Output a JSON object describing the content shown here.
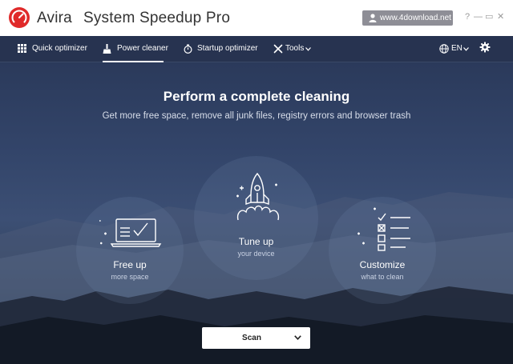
{
  "titlebar": {
    "brand": "Avira",
    "product": "System Speedup Pro",
    "account_label": "www.4download.net",
    "help": "?",
    "minimize": "—",
    "restore": "▭",
    "close": "✕"
  },
  "nav": {
    "items": [
      {
        "label": "Quick optimizer",
        "icon": "grid-icon"
      },
      {
        "label": "Power cleaner",
        "icon": "broom-icon"
      },
      {
        "label": "Startup optimizer",
        "icon": "stopwatch-icon"
      },
      {
        "label": "Tools",
        "icon": "tools-icon"
      }
    ],
    "active": "Power cleaner",
    "language": "EN"
  },
  "hero": {
    "title": "Perform a complete cleaning",
    "subtitle": "Get more free space, remove all junk files, registry errors and browser trash",
    "cards": [
      {
        "title": "Free up",
        "sub": "more space",
        "icon": "laptop-check-icon"
      },
      {
        "title": "Tune up",
        "sub": "your device",
        "icon": "rocket-icon"
      },
      {
        "title": "Customize",
        "sub": "what to clean",
        "icon": "checklist-icon"
      }
    ],
    "scan_label": "Scan"
  },
  "colors": {
    "brand_red": "#e02a2a",
    "nav_bg": "#273350",
    "account_bg": "#8e8e96"
  }
}
